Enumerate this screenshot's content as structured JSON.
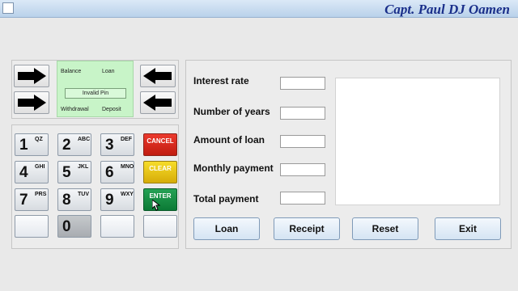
{
  "window": {
    "author": "Capt. Paul DJ Oamen"
  },
  "atm_screen": {
    "balance": "Balance",
    "loan": "Loan",
    "message": "Invalid Pin",
    "withdrawal": "Withdrawal",
    "deposit": "Deposit"
  },
  "keypad": {
    "keys": [
      {
        "num": "1",
        "sub": "QZ"
      },
      {
        "num": "2",
        "sub": "ABC"
      },
      {
        "num": "3",
        "sub": "DEF"
      },
      {
        "num": "4",
        "sub": "GHI"
      },
      {
        "num": "5",
        "sub": "JKL"
      },
      {
        "num": "6",
        "sub": "MNO"
      },
      {
        "num": "7",
        "sub": "PRS"
      },
      {
        "num": "8",
        "sub": "TUV"
      },
      {
        "num": "9",
        "sub": "WXY"
      },
      {
        "num": "0",
        "sub": ""
      }
    ],
    "cancel": "CANCEL",
    "clear": "CLEAR",
    "enter": "ENTER"
  },
  "form": {
    "interest_rate": "Interest rate",
    "years": "Number of years",
    "amount": "Amount  of loan",
    "monthly": "Monthly payment",
    "total": "Total payment",
    "values": {
      "interest_rate": "",
      "years": "",
      "amount": "",
      "monthly": "",
      "total": ""
    }
  },
  "buttons": {
    "loan": "Loan",
    "receipt": "Receipt",
    "reset": "Reset",
    "exit": "Exit"
  },
  "colors": {
    "screen": "#c8f4c8",
    "cancel": "#d9281c",
    "clear": "#e8c413",
    "enter": "#138a3f",
    "title": "#1a2f8a"
  }
}
